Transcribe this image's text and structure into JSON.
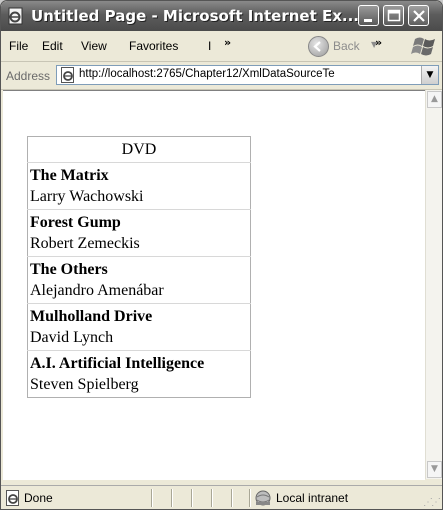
{
  "window": {
    "title": "Untitled Page - Microsoft Internet Ex..."
  },
  "menu": {
    "items": [
      "File",
      "Edit",
      "View",
      "Favorites",
      "I"
    ],
    "overflow": "»"
  },
  "toolbar": {
    "back_label": "Back",
    "overflow": "»"
  },
  "address": {
    "label": "Address",
    "url": "http://localhost:2765/Chapter12/XmlDataSourceTe"
  },
  "grid": {
    "header": "DVD",
    "rows": [
      {
        "title": "The Matrix",
        "director": "Larry Wachowski"
      },
      {
        "title": "Forest Gump",
        "director": "Robert Zemeckis"
      },
      {
        "title": "The Others",
        "director": "Alejandro Amenábar"
      },
      {
        "title": "Mulholland Drive",
        "director": "David Lynch"
      },
      {
        "title": "A.I. Artificial Intelligence",
        "director": "Steven Spielberg"
      }
    ]
  },
  "status": {
    "text": "Done",
    "zone": "Local intranet"
  },
  "icons": {
    "app": "ie-page-icon",
    "minimize": "minimize-icon",
    "maximize": "maximize-icon",
    "close": "close-icon",
    "back": "back-arrow-icon",
    "logo": "windows-flag-icon",
    "page": "page-icon",
    "zone": "intranet-icon"
  }
}
